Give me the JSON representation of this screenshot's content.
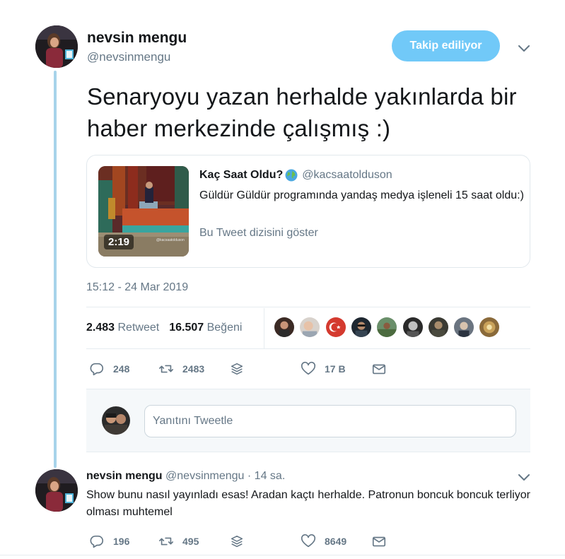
{
  "thread": {
    "main_tweet": {
      "author_name": "nevsin mengu",
      "author_handle": "@nevsinmengu",
      "follow_button_label": "Takip ediliyor",
      "text": "Senaryoyu yazan herhalde yakınlarda bir haber merkezinde çalışmış :)",
      "timestamp": "15:12 - 24 Mar 2019",
      "stats": {
        "retweets_count": "2.483",
        "retweets_label": "Retweet",
        "likes_count": "16.507",
        "likes_label": "Beğeni"
      },
      "actions": {
        "reply_count": "248",
        "retweet_count": "2483",
        "like_count": "17 B"
      }
    },
    "quoted_tweet": {
      "author_name": "Kaç Saat Oldu?",
      "author_handle": "@kacsaatolduson",
      "text": "Güldür Güldür programında yandaş medya işleneli 15 saat oldu:)",
      "show_thread_label": "Bu Tweet dizisini göster",
      "video_duration": "2:19",
      "thumb_watermark": "@kacsaatolduson"
    },
    "reply_composer": {
      "placeholder": "Yanıtını Tweetle"
    },
    "reply_tweet": {
      "author_name": "nevsin mengu",
      "author_handle": "@nevsinmengu",
      "time_ago": "· 14 sa.",
      "text": "Show bunu nasıl yayınladı esas! Aradan kaçtı herhalde. Patronun boncuk boncuk terliyor olması muhtemel",
      "actions": {
        "reply_count": "196",
        "retweet_count": "495",
        "like_count": "8649"
      }
    }
  },
  "icons": [
    "reply-icon",
    "retweet-icon",
    "stack-icon",
    "heart-icon",
    "mail-icon",
    "chevron-down-icon",
    "globe-icon"
  ],
  "colors": {
    "accent": "#1da1f2",
    "follow_button": "#71c9f8",
    "thread_line": "#a7d3ea",
    "secondary_text": "#657786"
  }
}
